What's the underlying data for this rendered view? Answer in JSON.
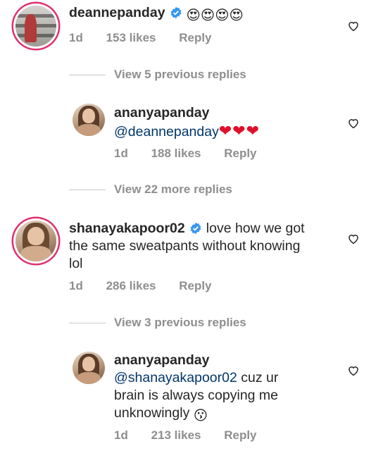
{
  "comments": [
    {
      "username": "deannepanday",
      "text": "",
      "emoji": "😍😍😍😍",
      "time": "1d",
      "likes": "153 likes",
      "reply": "Reply"
    },
    {
      "view_replies": "View 5 previous replies"
    },
    {
      "username": "ananyapanday",
      "mention": "@deannepanday",
      "emoji": "❤❤❤",
      "time": "1d",
      "likes": "188 likes",
      "reply": "Reply"
    },
    {
      "view_replies": "View 22 more replies"
    },
    {
      "username": "shanayakapoor02",
      "text_line1": "love how we got",
      "text_line2": "the same sweatpants without knowing",
      "text_line3": "lol",
      "time": "1d",
      "likes": "286 likes",
      "reply": "Reply"
    },
    {
      "view_replies": "View 3 previous replies"
    },
    {
      "username": "ananyapanday",
      "mention": "@shanayakapoor02",
      "text_line1": " cuz ur",
      "text_line2": "brain is always copying me",
      "text_line3": "unknowingly",
      "emoji": "😗",
      "time": "1d",
      "likes": "213 likes",
      "reply": "Reply"
    }
  ],
  "icons": {
    "verified": "verified-badge-icon",
    "like": "heart-outline-icon"
  },
  "colors": {
    "username": "#262626",
    "mention": "#00376b",
    "meta": "#8e8e8e",
    "verified": "#3897f0",
    "story_ring": "#e0306d"
  }
}
